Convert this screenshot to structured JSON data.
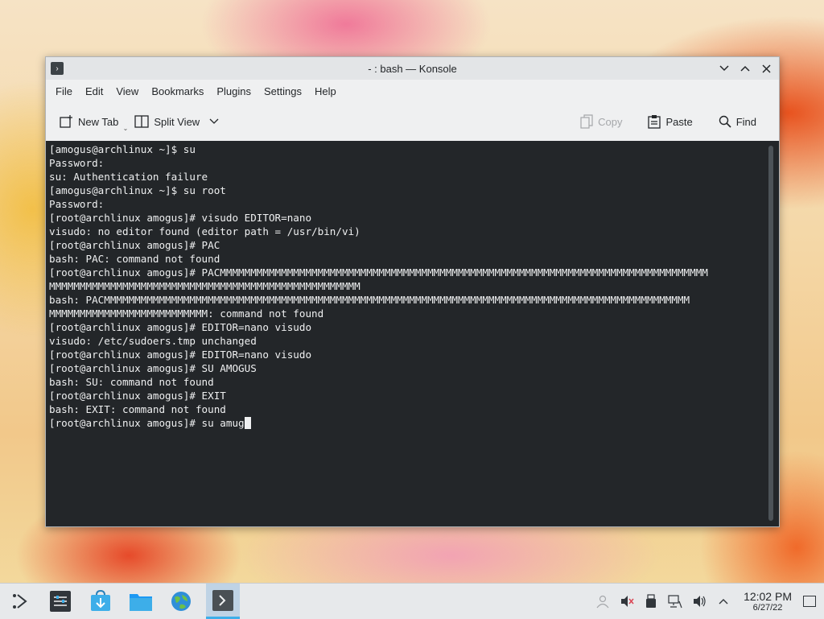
{
  "window": {
    "title": "- : bash — Konsole",
    "menu": [
      "File",
      "Edit",
      "View",
      "Bookmarks",
      "Plugins",
      "Settings",
      "Help"
    ],
    "toolbar": {
      "new_tab": "New Tab",
      "split_view": "Split View",
      "copy": "Copy",
      "paste": "Paste",
      "find": "Find"
    }
  },
  "terminal": {
    "lines": [
      "[amogus@archlinux ~]$ su",
      "Password:",
      "su: Authentication failure",
      "[amogus@archlinux ~]$ su root",
      "Password:",
      "[root@archlinux amogus]# visudo EDITOR=nano",
      "visudo: no editor found (editor path = /usr/bin/vi)",
      "[root@archlinux amogus]# PAC",
      "bash: PAC: command not found",
      "[root@archlinux amogus]# PACMMMMMMMMMMMMMMMMMMMMMMMMMMMMMMMMMMMMMMMMMMMMMMMMMMMMMMMMMMMMMMMMMMMMMMMMMMMMMMMM",
      "MMMMMMMMMMMMMMMMMMMMMMMMMMMMMMMMMMMMMMMMMMMMMMMMMMM",
      "bash: PACMMMMMMMMMMMMMMMMMMMMMMMMMMMMMMMMMMMMMMMMMMMMMMMMMMMMMMMMMMMMMMMMMMMMMMMMMMMMMMMMMMMMMMMMMMMMMMMM",
      "MMMMMMMMMMMMMMMMMMMMMMMMMM: command not found",
      "[root@archlinux amogus]# EDITOR=nano visudo",
      "visudo: /etc/sudoers.tmp unchanged",
      "[root@archlinux amogus]# EDITOR=nano visudo",
      "[root@archlinux amogus]# SU AMOGUS",
      "bash: SU: command not found",
      "[root@archlinux amogus]# EXIT",
      "bash: EXIT: command not found"
    ],
    "current_prompt": "[root@archlinux amogus]# su amug"
  },
  "taskbar": {
    "items": [
      "application-launcher-icon",
      "system-settings-icon",
      "discover-icon",
      "dolphin-icon",
      "web-browser-icon",
      "konsole-icon"
    ],
    "clock": {
      "time": "12:02 PM",
      "date": "6/27/22"
    }
  },
  "colors": {
    "terminal_bg": "#232629",
    "terminal_fg": "#eff0f1",
    "accent": "#3daee9"
  }
}
